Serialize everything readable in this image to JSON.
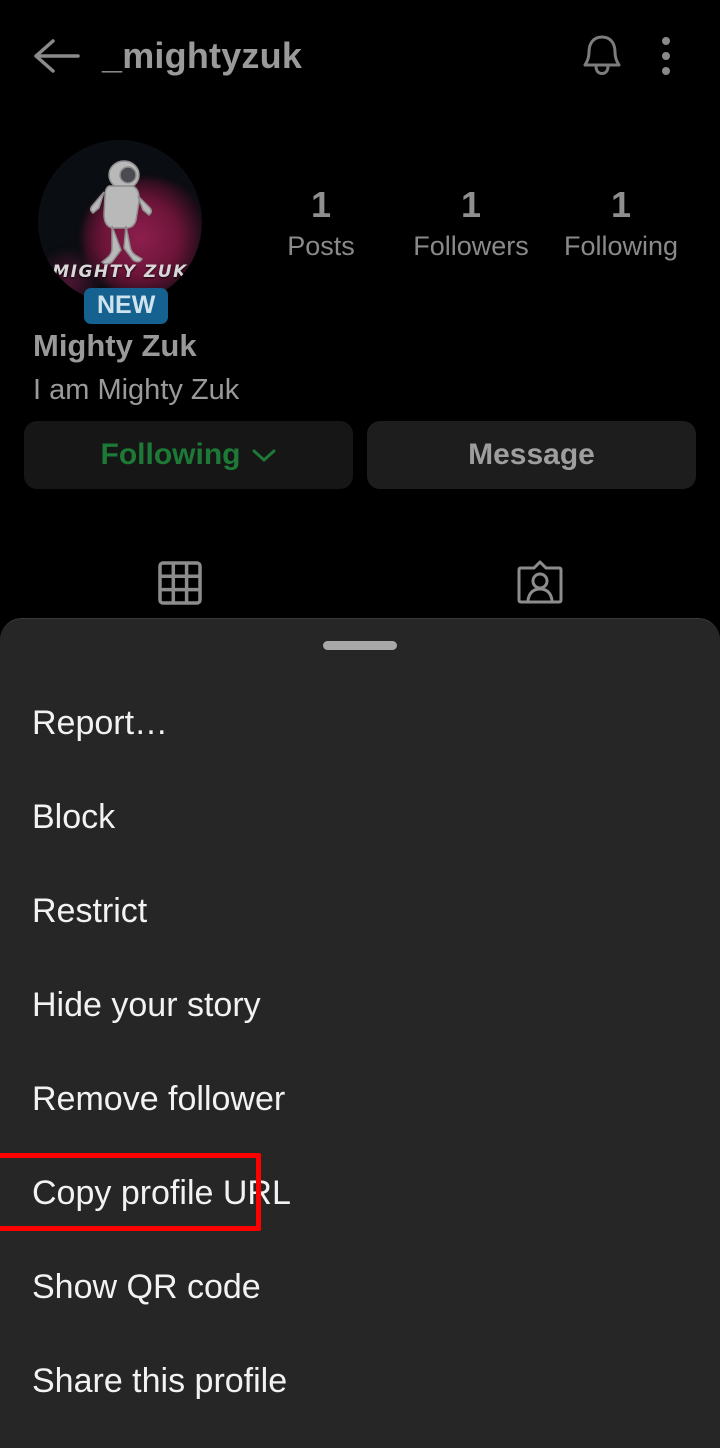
{
  "header": {
    "back_icon": "arrow-left-icon",
    "title": "_mightyzuk",
    "bell_icon": "bell-icon",
    "overflow_icon": "kebab-menu-icon"
  },
  "profile": {
    "avatar_caption": "MIGHTY ZUK",
    "avatar_alt": "astronaut-profile-photo",
    "new_badge": "NEW",
    "display_name": "Mighty Zuk",
    "bio": "I am Mighty Zuk",
    "stats": [
      {
        "value": "1",
        "label": "Posts"
      },
      {
        "value": "1",
        "label": "Followers"
      },
      {
        "value": "1",
        "label": "Following"
      }
    ],
    "buttons": {
      "following": "Following",
      "following_chevron": "chevron-down-icon",
      "message": "Message"
    },
    "tabs": [
      {
        "icon": "grid-icon",
        "name": "posts-grid-tab"
      },
      {
        "icon": "tagged-person-card-icon",
        "name": "tagged-tab"
      }
    ]
  },
  "sheet": {
    "handle": "drag-handle",
    "items": [
      {
        "label": "Report…",
        "highlighted": false
      },
      {
        "label": "Block",
        "highlighted": false
      },
      {
        "label": "Restrict",
        "highlighted": false
      },
      {
        "label": "Hide your story",
        "highlighted": false
      },
      {
        "label": "Remove follower",
        "highlighted": false
      },
      {
        "label": "Copy profile URL",
        "highlighted": true
      },
      {
        "label": "Show QR code",
        "highlighted": false
      },
      {
        "label": "Share this profile",
        "highlighted": false
      }
    ]
  },
  "colors": {
    "background": "#000000",
    "sheet_background": "#262626",
    "following_green": "#1d7a36",
    "badge_blue": "#15618f",
    "highlight_red": "#ff0000",
    "primary_text": "#f2f2f2",
    "muted_text": "#9a9a9a"
  }
}
